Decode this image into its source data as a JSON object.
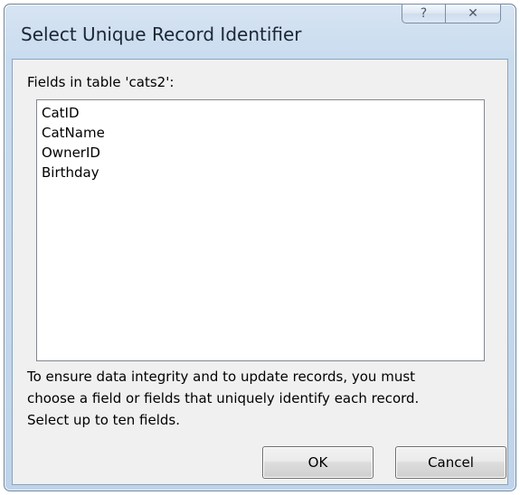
{
  "window": {
    "title": "Select Unique Record Identifier",
    "help_glyph": "?",
    "close_glyph": "✕"
  },
  "fields_label": "Fields in table 'cats2':",
  "fields": [
    {
      "label": "CatID"
    },
    {
      "label": "CatName"
    },
    {
      "label": "OwnerID"
    },
    {
      "label": "Birthday"
    }
  ],
  "description": {
    "line1": "To ensure data integrity and to update records, you must",
    "line2": "choose a field or fields that uniquely identify each record.",
    "line3": "Select up to ten fields."
  },
  "buttons": {
    "ok": "OK",
    "cancel": "Cancel"
  }
}
